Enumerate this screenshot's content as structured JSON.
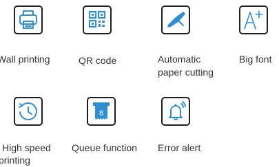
{
  "features": [
    {
      "id": "wall-printing",
      "icon": "printer-icon",
      "label": "Wall printing"
    },
    {
      "id": "qr-code",
      "icon": "qr-code-icon",
      "label": "QR code"
    },
    {
      "id": "automatic-paper-cutting",
      "icon": "knife-icon",
      "label_lines": [
        "Automatic",
        "paper cutting"
      ]
    },
    {
      "id": "big-font",
      "icon": "a-plus-icon",
      "label": "Big font"
    },
    {
      "id": "high-speed-printing",
      "icon": "clock-icon",
      "label_lines": [
        "High speed",
        "printing"
      ]
    },
    {
      "id": "queue-function",
      "icon": "queue-ticket-icon",
      "label": "Queue function",
      "ticket_number": "8"
    },
    {
      "id": "error-alert",
      "icon": "bell-alert-icon",
      "label": "Error alert"
    }
  ],
  "colors": {
    "icon_blue": "#2f8fd2",
    "icon_dark": "#1f1f1f",
    "text": "#333333"
  }
}
